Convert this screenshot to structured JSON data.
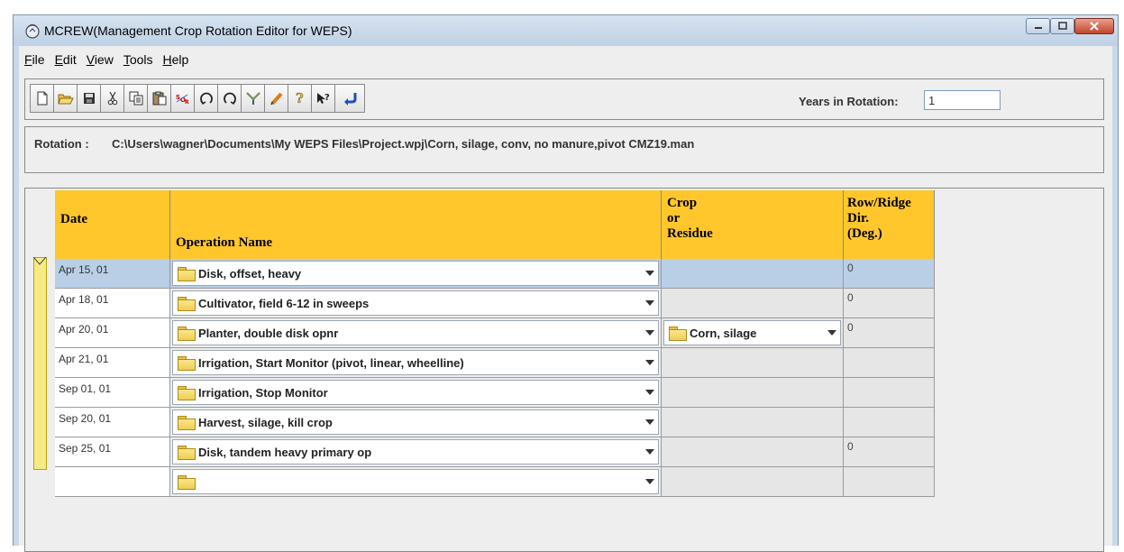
{
  "window": {
    "title": "MCREW(Management Crop Rotation Editor for WEPS)"
  },
  "menu": [
    {
      "label": "File",
      "u": "F",
      "rest": "ile"
    },
    {
      "label": "Edit",
      "u": "E",
      "rest": "dit"
    },
    {
      "label": "View",
      "u": "V",
      "rest": "iew"
    },
    {
      "label": "Tools",
      "u": "T",
      "rest": "ools"
    },
    {
      "label": "Help",
      "u": "H",
      "rest": "elp"
    }
  ],
  "toolbar": {
    "icons": [
      "new-file-icon",
      "open-folder-icon",
      "save-icon",
      "cut-icon",
      "copy-icon",
      "paste-icon",
      "sort-icon",
      "undo-icon",
      "redo-icon",
      "filter-icon",
      "edit-pencil-icon",
      "help-icon",
      "context-help-icon",
      "return-icon"
    ],
    "years_label": "Years in Rotation:",
    "years_value": "1"
  },
  "rotation": {
    "label": "Rotation :",
    "value": "C:\\Users\\wagner\\Documents\\My WEPS Files\\Project.wpj\\Corn, silage, conv, no manure,pivot CMZ19.man"
  },
  "table": {
    "headers": {
      "date": "Date",
      "operation": "Operation Name",
      "crop_line1": "Crop",
      "crop_line2": "or",
      "crop_line3": "Residue",
      "dir_line1": "Row/Ridge",
      "dir_line2": "Dir.",
      "dir_line3": "(Deg.)"
    },
    "rows": [
      {
        "date": "Apr 15, 01",
        "operation": "Disk, offset, heavy",
        "crop": "",
        "dir": "0"
      },
      {
        "date": "Apr 18, 01",
        "operation": "Cultivator, field 6-12 in sweeps",
        "crop": "",
        "dir": "0"
      },
      {
        "date": "Apr 20, 01",
        "operation": "Planter, double disk opnr",
        "crop": "Corn, silage",
        "dir": "0"
      },
      {
        "date": "Apr 21, 01",
        "operation": "Irrigation, Start Monitor (pivot, linear, wheelline)",
        "crop": "",
        "dir": ""
      },
      {
        "date": "Sep 01, 01",
        "operation": "Irrigation, Stop Monitor",
        "crop": "",
        "dir": ""
      },
      {
        "date": "Sep 20, 01",
        "operation": "Harvest, silage, kill crop",
        "crop": "",
        "dir": ""
      },
      {
        "date": "Sep 25, 01",
        "operation": "Disk, tandem heavy primary op",
        "crop": "",
        "dir": "0"
      },
      {
        "date": "",
        "operation": "",
        "crop": "",
        "dir": ""
      }
    ]
  },
  "colors": {
    "header_bg": "#ffc72c",
    "selected_row": "#b8cfe6",
    "window_bg": "#c9d9ea"
  }
}
